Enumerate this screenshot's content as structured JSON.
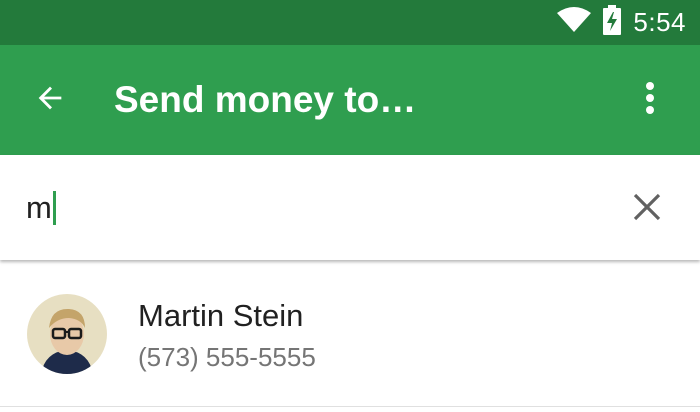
{
  "status_bar": {
    "time": "5:54",
    "icons": [
      "wifi-icon",
      "battery-charging-icon"
    ]
  },
  "app_bar": {
    "title": "Send money to…",
    "back_icon": "arrow-back-icon",
    "menu_icon": "more-vert-icon"
  },
  "search": {
    "value": "m",
    "clear_icon": "close-icon"
  },
  "contacts": [
    {
      "name": "Martin Stein",
      "phone": "(573) 555-5555"
    }
  ],
  "colors": {
    "status_bar": "#237a3b",
    "app_bar": "#2f9e4f",
    "accent": "#2f9e4f"
  }
}
